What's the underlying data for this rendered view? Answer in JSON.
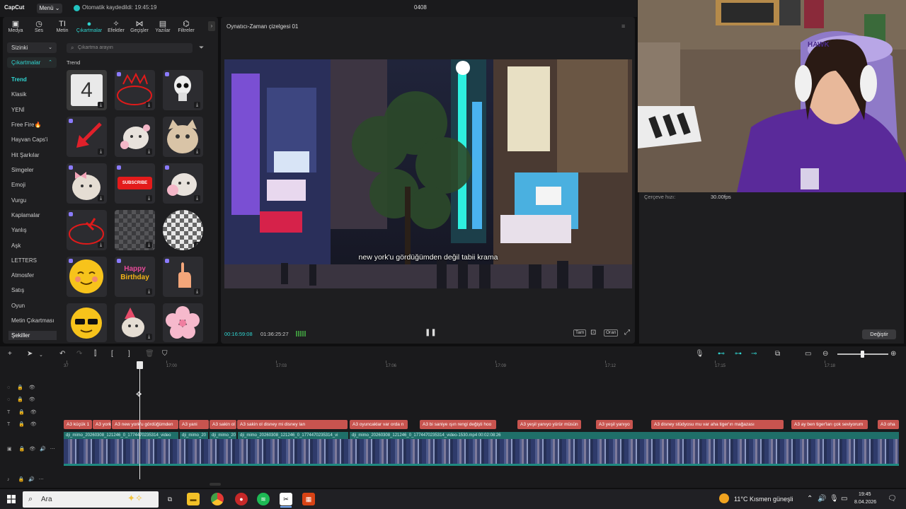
{
  "titlebar": {
    "logo": "CapCut",
    "menu_label": "Menü",
    "saved_status": "Otomatik kaydedildi: 19:45:19",
    "project_name": "0408"
  },
  "tabs": [
    {
      "label": "Medya",
      "icon": "media-icon"
    },
    {
      "label": "Ses",
      "icon": "audio-icon"
    },
    {
      "label": "Metin",
      "icon": "text-icon"
    },
    {
      "label": "Çıkartmalar",
      "icon": "sticker-icon"
    },
    {
      "label": "Efektler",
      "icon": "effects-icon"
    },
    {
      "label": "Geçişler",
      "icon": "transitions-icon"
    },
    {
      "label": "Yazılar",
      "icon": "captions-icon"
    },
    {
      "label": "Filtreler",
      "icon": "filters-icon"
    }
  ],
  "sidebar": {
    "dropdown_label": "Sizinki",
    "category_label": "Çıkartmalar",
    "items": [
      "Trend",
      "Klasik",
      "YENİ",
      "Free Fire🔥",
      "Hayvan Caps'i",
      "Hit Şarkılar",
      "Simgeler",
      "Emoji",
      "Vurgu",
      "Kaplamalar",
      "Yanlış",
      "Aşk",
      "LETTERS",
      "Atmosfer",
      "Satış",
      "Oyun",
      "Metin Çıkartması",
      "Şekiller"
    ]
  },
  "stickers": {
    "search_placeholder": "Çıkartma arayın",
    "section_title": "Trend",
    "subscribe_text": "SUBSCRIBE",
    "happy_text": "Happy",
    "birthday_text": "Birthday",
    "countdown_digit": "4"
  },
  "player": {
    "title": "Oynatıcı-Zaman çizelgesi 01",
    "subtitle": "new york'u gördüğümden değil tabii krama",
    "timecode_current": "00:16:59:08",
    "timecode_total": "01:36:25:27",
    "full_btn": "Tam",
    "ratio_btn": "Oran"
  },
  "properties": {
    "fps_label": "Çerçeve hızı:",
    "fps_value": "30.00fps",
    "change_btn": "Değiştir"
  },
  "webcam": {
    "cap_text": "HAWK"
  },
  "timeline": {
    "ruler_labels": [
      "37",
      "17:00",
      "17:03",
      "17:06",
      "17:09",
      "17:12",
      "17:15",
      "17:18"
    ],
    "text_clips": [
      "A3 küçük 1",
      "A3 york g",
      "A3 new york'u gördüğümden",
      "A3 yani",
      "A3 sakin ol",
      "A3 sakin ol disney mi disney lan",
      "A3 oyuncaklar var orda n",
      "A3 bi saniye ışın rengi değişti hoo",
      "A3 yeşil yanıyo yürür müsün",
      "A3 yeşil yanıyo",
      "A3 disney stüdyosu mu var aha tiger'ın mağazası",
      "A3 ay ben tiger'ları çok seviyorum",
      "A3 oha"
    ],
    "video_labels": [
      "dji_mimo_20260308_121246_0_1774470235314_video",
      "dji_mimo_20",
      "dji_mimo_20",
      "dji_mimo_20260308_121246_0_1774470235314_vi",
      "dji_mimo_20260308_121246_0_1774470235314_video-1530.mp4   00:02:08:26"
    ]
  },
  "taskbar": {
    "search_text": "Ara",
    "weather": "11°C  Kısmen güneşli",
    "time": "19:45",
    "date": "8.04.2026"
  }
}
